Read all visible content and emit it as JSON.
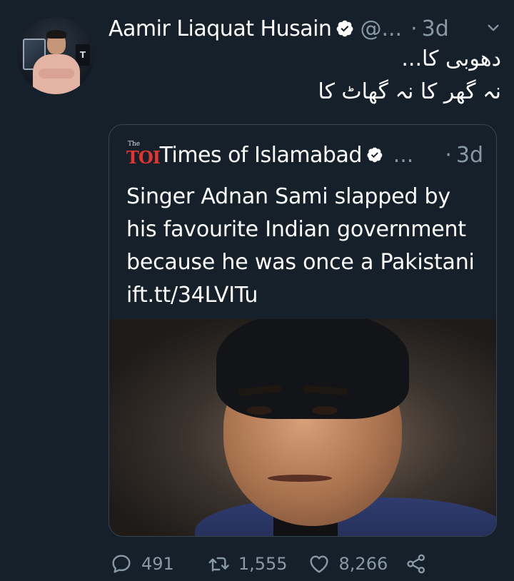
{
  "tweet": {
    "author_name": "Aamir Liaquat Husain",
    "handle": "@...",
    "dot": "·",
    "time": "3d",
    "text_line1": "دھوبی کا...",
    "text_line2": "نہ گھر کا نہ گھاٹ کا"
  },
  "quoted": {
    "logo_small": "The",
    "logo_main": "TOI",
    "author_name": "Times of Islamabad",
    "ellipsis": "...",
    "dot": "·",
    "time": "3d",
    "text_line1": "Singer Adnan Sami slapped by",
    "text_line2": "his favourite Indian government",
    "text_line3": "because he was once a Pakistani",
    "text_line4": "ift.tt/34LVITu"
  },
  "actions": {
    "reply_count": "491",
    "retweet_count": "1,555",
    "like_count": "8,266"
  },
  "colors": {
    "background": "#15202b",
    "muted": "#8899a6",
    "border": "#38444d",
    "toi_red": "#e3342f"
  }
}
